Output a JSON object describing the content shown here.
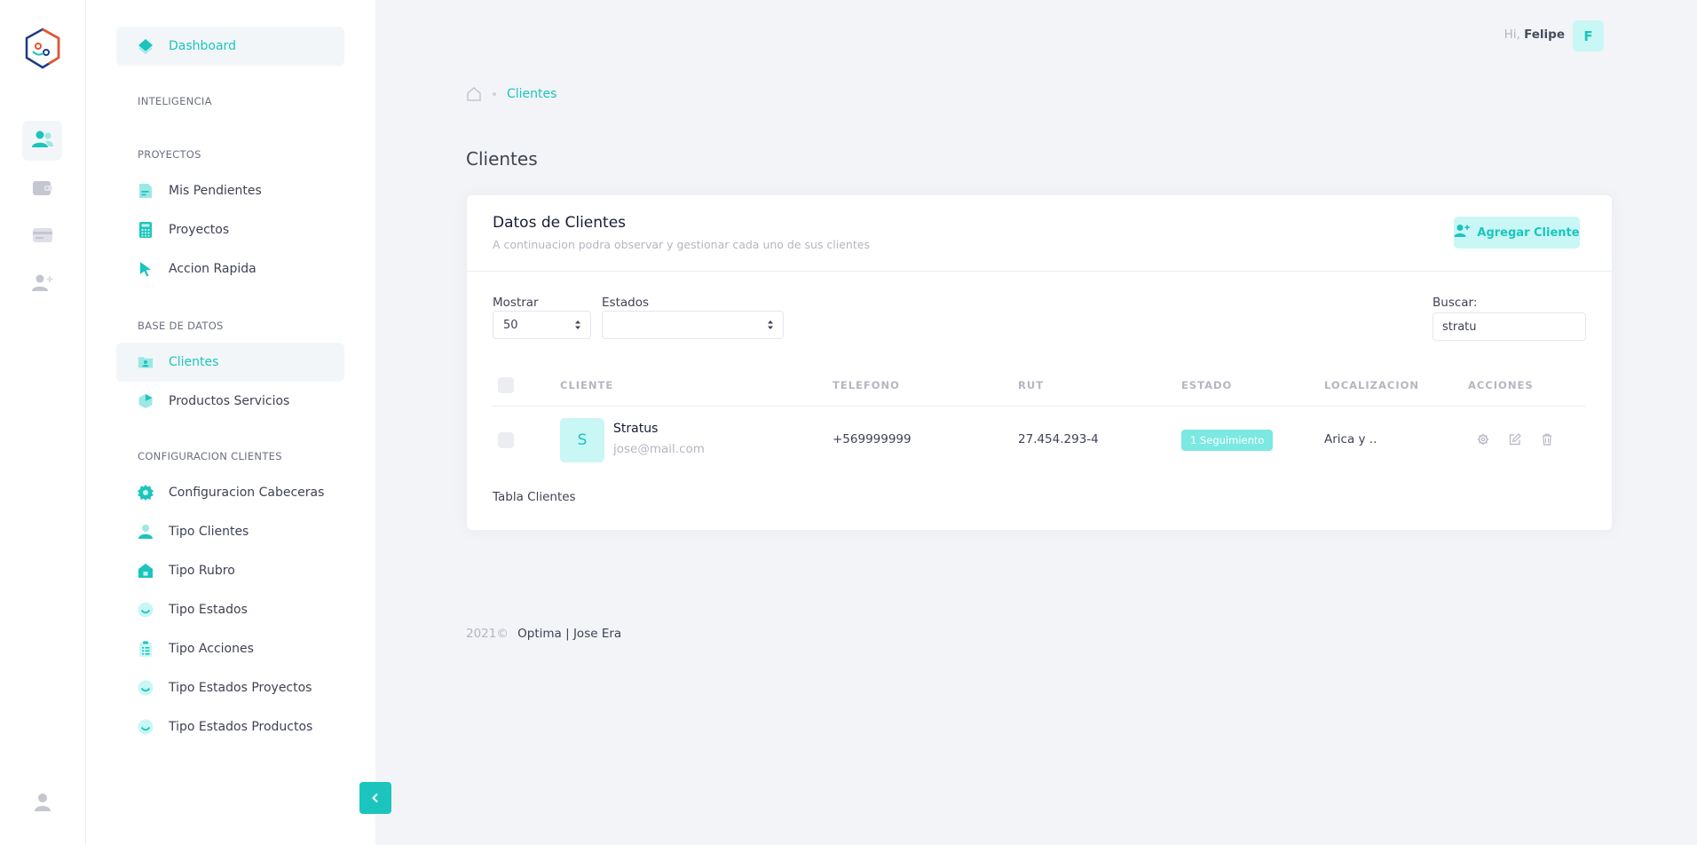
{
  "colors": {
    "accent": "#1bc5bd",
    "accent_light": "#c9f7f5",
    "badge": "#7ce8e2",
    "muted": "#b5b5c3",
    "logo_blue": "#1e3a8a",
    "logo_orange": "#e8552b"
  },
  "rail": {
    "items": [
      {
        "name": "clientes",
        "icon": "users-icon",
        "active": true
      },
      {
        "name": "wallet",
        "icon": "wallet-icon",
        "active": false
      },
      {
        "name": "card",
        "icon": "credit-card-icon",
        "active": false
      },
      {
        "name": "add-user",
        "icon": "add-user-icon",
        "active": false
      }
    ],
    "profile_icon": "user-icon"
  },
  "menu": {
    "dashboard": "Dashboard",
    "sections": {
      "inteligencia": "INTELIGENCIA",
      "proyectos": "PROYECTOS",
      "base_datos": "BASE DE DATOS",
      "config": "CONFIGURACION CLIENTES"
    },
    "items": {
      "mis_pendientes": "Mis Pendientes",
      "proyectos": "Proyectos",
      "accion_rapida": "Accion Rapida",
      "clientes": "Clientes",
      "productos": "Productos Servicios",
      "config_cabeceras": "Configuracion Cabeceras",
      "tipo_clientes": "Tipo Clientes",
      "tipo_rubro": "Tipo Rubro",
      "tipo_estados": "Tipo Estados",
      "tipo_acciones": "Tipo Acciones",
      "tipo_estados_proyectos": "Tipo Estados Proyectos",
      "tipo_estados_productos": "Tipo Estados Productos"
    }
  },
  "header": {
    "greeting": "Hi,",
    "user": "Felipe",
    "avatar_letter": "F"
  },
  "breadcrumb": {
    "current": "Clientes"
  },
  "page": {
    "title": "Clientes"
  },
  "card": {
    "title": "Datos de Clientes",
    "subtitle": "A continuacion podra observar y gestionar cada uno de sus clientes",
    "add_button": "Agregar Cliente",
    "filters": {
      "mostrar_label": "Mostrar",
      "mostrar_value": "50",
      "estados_label": "Estados",
      "estados_value": "",
      "buscar_label": "Buscar:",
      "buscar_value": "stratu"
    },
    "columns": [
      "CLIENTE",
      "TELEFONO",
      "RUT",
      "ESTADO",
      "LOCALIZACION",
      "ACCIONES"
    ],
    "rows": [
      {
        "avatar_letter": "S",
        "name": "Stratus",
        "email": "jose@mail.com",
        "telefono": "+569999999",
        "rut": "27.454.293-4",
        "estado": "1 Seguimiento",
        "localizacion": "Arica y .."
      }
    ],
    "caption": "Tabla Clientes"
  },
  "footer": {
    "year": "2021©",
    "brand": "Optima | Jose Era"
  }
}
